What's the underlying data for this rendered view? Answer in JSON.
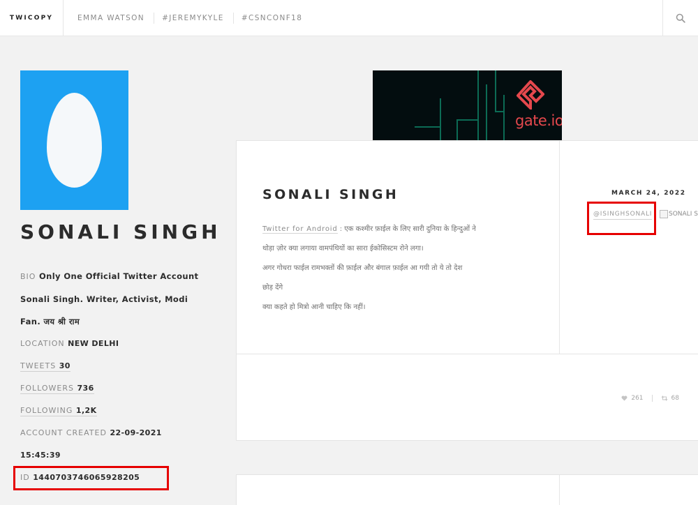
{
  "topbar": {
    "logo": "TWICOPY",
    "nav": [
      "EMMA WATSON",
      "#JEREMYKYLE",
      "#CSNCONF18"
    ],
    "search_icon": "search-icon"
  },
  "profile": {
    "name": "SONALI SINGH",
    "bio_label": "BIO",
    "bio_line1": "Only One Official Twitter Account",
    "bio_line2": "Sonali Singh. Writer, Activist, Modi",
    "bio_line3": "Fan. जय श्री राम",
    "location_label": "LOCATION",
    "location_value": "NEW DELHI",
    "tweets_label": "TWEETS",
    "tweets_value": "30",
    "followers_label": "FOLLOWERS",
    "followers_value": "736",
    "following_label": "FOLLOWING",
    "following_value": "1,2K",
    "created_label": "ACCOUNT CREATED",
    "created_date": "22-09-2021",
    "created_time": "15:45:39",
    "id_label": "ID",
    "id_value": "1440703746065928205"
  },
  "banner": {
    "brand": "gate.io"
  },
  "tweet": {
    "author": "SONALI SINGH",
    "source": "Twitter for Android",
    "source_sep": ":",
    "line1": "एक कश्मीर फ़ाईल के लिए सारी दुनिया के हिन्दुओं ने",
    "line2": "थोड़ा ज़ोर क्या लगाया वामपंथियों का सारा ईकोसिस्टम रोने लगा।",
    "line3": "अगर गोधरा फाईल रामभक्तों की फ़ाईल और बंगाल फ़ाईल आ गयी तो ये तो देश",
    "line4": "छोड़ देंगे",
    "line5": "क्या कहते हो मित्रो आनी चाहिए कि नहीं।",
    "date": "MARCH 24, 2022",
    "handle": "@ISINGHSONALI",
    "image_alt": "SONALI SINGH",
    "likes": "261",
    "retweets": "68"
  }
}
